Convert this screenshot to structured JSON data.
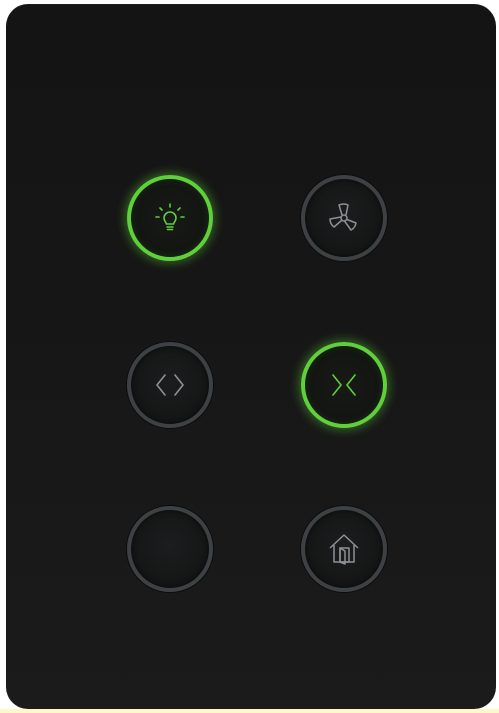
{
  "panel": {
    "buttons": [
      {
        "name": "light",
        "icon": "lightbulb-icon",
        "state": "on"
      },
      {
        "name": "fan",
        "icon": "fan-icon",
        "state": "off"
      },
      {
        "name": "curtain-open",
        "icon": "chevrons-outward-icon",
        "state": "off"
      },
      {
        "name": "curtain-close",
        "icon": "chevrons-inward-icon",
        "state": "on"
      },
      {
        "name": "blank",
        "icon": "",
        "state": "off"
      },
      {
        "name": "home-exit",
        "icon": "house-exit-icon",
        "state": "off"
      }
    ]
  },
  "colors": {
    "panel_background": "#161616",
    "ring_off": "#3e4144",
    "ring_on": "#5fcf3a",
    "icon_off": "#8d9194",
    "icon_on": "#5fcf3a"
  }
}
